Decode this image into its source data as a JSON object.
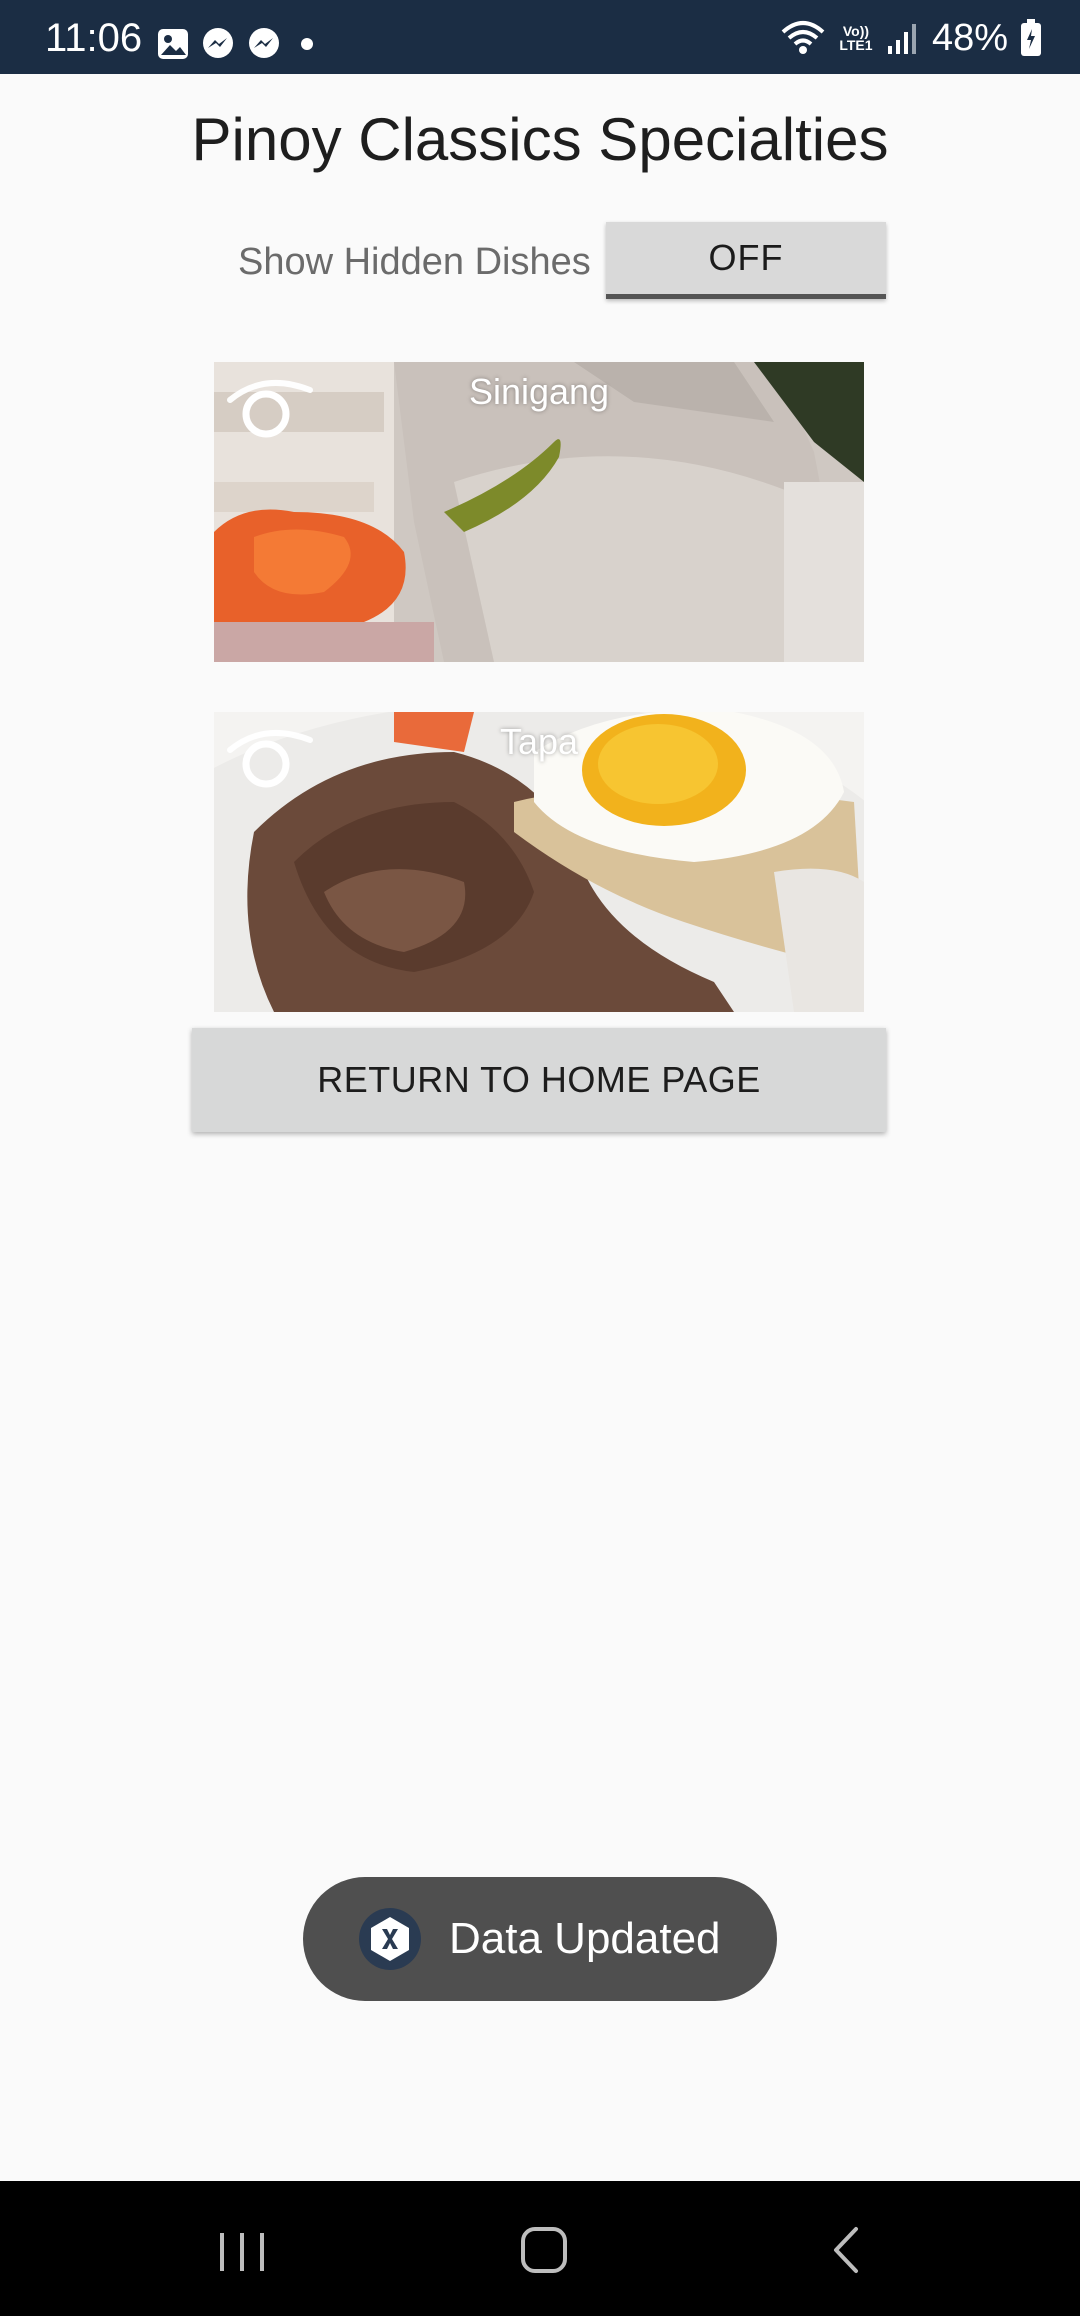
{
  "status_bar": {
    "time": "11:06",
    "battery": "48%",
    "network": "Vo)) LTE1",
    "left_icons": [
      "gallery-icon",
      "messenger-icon",
      "messenger-icon",
      "dot-icon"
    ],
    "right_icons": [
      "wifi-icon",
      "volte-icon",
      "signal-icon",
      "battery-charging-icon"
    ]
  },
  "page": {
    "title": "Pinoy Classics Specialties"
  },
  "toggle": {
    "label": "Show Hidden Dishes",
    "state": "OFF"
  },
  "dishes": [
    {
      "name": "Sinigang",
      "icon": "hide-toggle-icon"
    },
    {
      "name": "Tapa",
      "icon": "hide-toggle-icon"
    }
  ],
  "return_button": {
    "label": "RETURN TO HOME PAGE"
  },
  "toast": {
    "text": "Data Updated",
    "icon": "xamarin-icon"
  },
  "nav": {
    "buttons": [
      "recent-apps-icon",
      "home-icon",
      "back-icon"
    ]
  },
  "colors": {
    "status_bar": "#1b2d44",
    "background": "#fafafa",
    "button": "#d7d8d8",
    "toast": "#4f4f4f"
  }
}
